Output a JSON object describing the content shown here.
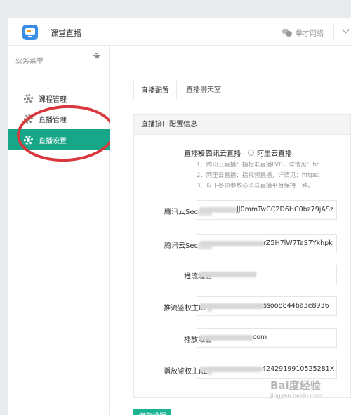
{
  "header": {
    "app_title": "课堂直播",
    "user_name": "举才网络"
  },
  "sidebar": {
    "title": "业务菜单",
    "items": [
      {
        "label": "课程管理"
      },
      {
        "label": "直播管理"
      },
      {
        "label": "直播设置"
      }
    ]
  },
  "tabs": [
    {
      "label": "直播配置"
    },
    {
      "label": "直播聊天室"
    }
  ],
  "panel": {
    "title": "直播接口配置信息",
    "interface_label": "直播接口",
    "radio_options": [
      "腾讯云直播",
      "阿里云直播"
    ],
    "help_lines": [
      "1、腾讯云直播：指标准直播LVB，详情见：ht",
      "2、阿里云直播：指视频直播，详情见：https:",
      "3、以下各项参数必须与直播平台保持一致。"
    ],
    "fields": [
      {
        "label": "腾讯云Sec",
        "value": "JJ0mmTwCC2D6HC0bz79jASz"
      },
      {
        "label": "腾讯云Sec",
        "value": "rZ5H7lW7TaS7Ykhpk"
      },
      {
        "label": "推流域名",
        "value": ""
      },
      {
        "label": "推流鉴权主KE",
        "value": "ssoo8844ba3e8936"
      },
      {
        "label": "播放域名",
        "value": "com"
      },
      {
        "label": "播放鉴权主KE",
        "value": "4242919910525281X"
      }
    ]
  },
  "save_button": "保存设置",
  "watermark": {
    "title": "Bai度经验",
    "url": "jingyan.baidu.com"
  }
}
